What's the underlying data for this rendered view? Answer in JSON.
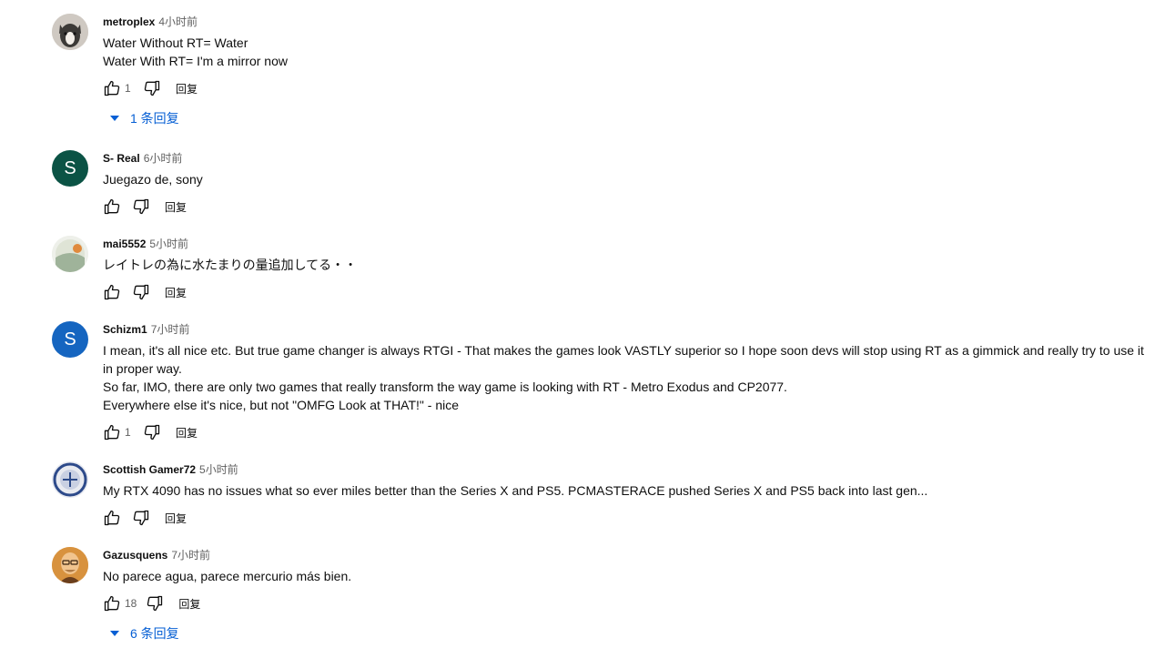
{
  "reply_label": "回复",
  "comments": [
    {
      "author": "metroplex",
      "time": "4小时前",
      "text": "Water Without RT= Water\nWater With RT= I'm a mirror now",
      "likes": "1",
      "replies": "1 条回复",
      "avatar": {
        "type": "photo",
        "colors": [
          "#d8d2cb",
          "#3c3a37"
        ]
      }
    },
    {
      "author": "S- Real",
      "time": "6小时前",
      "text": "Juegazo de, sony",
      "likes": "",
      "replies": "",
      "avatar": {
        "type": "letter",
        "letter": "S",
        "color": "#0b5345"
      }
    },
    {
      "author": "mai5552",
      "time": "5小时前",
      "text": "レイトレの為に水たまりの量追加してる・・",
      "likes": "",
      "replies": "",
      "avatar": {
        "type": "photo",
        "colors": [
          "#e9ece4",
          "#9fb39a"
        ]
      }
    },
    {
      "author": "Schizm1",
      "time": "7小时前",
      "text": "I mean, it's all nice etc. But true game changer is always RTGI - That makes the games look VASTLY superior so I hope soon devs will stop using RT as a gimmick and really try to use it in proper way.\nSo far, IMO, there are only two games that really transform the way game is looking with RT - Metro Exodus and CP2077.\nEverywhere else it's nice, but not \"OMFG Look at THAT!\" - nice",
      "likes": "1",
      "replies": "",
      "avatar": {
        "type": "letter",
        "letter": "S",
        "color": "#1565c0"
      }
    },
    {
      "author": "Scottish Gamer72",
      "time": "5小时前",
      "text": "My RTX 4090 has no issues what so ever miles better than the Series X and PS5. PCMASTERACE pushed Series X and PS5 back into last gen...",
      "likes": "",
      "replies": "",
      "avatar": {
        "type": "badge",
        "colors": [
          "#e8eaf0",
          "#2d4a8a"
        ]
      }
    },
    {
      "author": "Gazusquens",
      "time": "7小时前",
      "text": "No parece agua, parece mercurio más bien.",
      "likes": "18",
      "replies": "6 条回复",
      "avatar": {
        "type": "photo",
        "colors": [
          "#e0a14a",
          "#6a3e1c"
        ]
      }
    }
  ]
}
